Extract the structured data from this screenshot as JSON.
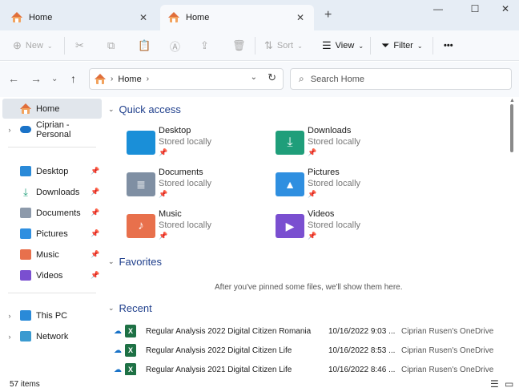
{
  "tabs": [
    {
      "title": "Home",
      "active": false
    },
    {
      "title": "Home",
      "active": true
    }
  ],
  "window_controls": {
    "minimize": "—",
    "maximize": "☐",
    "close": "✕"
  },
  "toolbar": {
    "new_label": "New",
    "sort_label": "Sort",
    "view_label": "View",
    "filter_label": "Filter",
    "more": "•••"
  },
  "address": {
    "current": "Home"
  },
  "search": {
    "placeholder": "Search Home"
  },
  "sidebar": {
    "items": [
      {
        "label": "Home",
        "icon": "home-icon",
        "selected": true
      },
      {
        "label": "Ciprian - Personal",
        "icon": "cloud-icon"
      },
      {
        "label": "Desktop",
        "icon": "desktop-icon",
        "pinned": true
      },
      {
        "label": "Downloads",
        "icon": "downloads-icon",
        "pinned": true
      },
      {
        "label": "Documents",
        "icon": "documents-icon",
        "pinned": true
      },
      {
        "label": "Pictures",
        "icon": "pictures-icon",
        "pinned": true
      },
      {
        "label": "Music",
        "icon": "music-icon",
        "pinned": true
      },
      {
        "label": "Videos",
        "icon": "videos-icon",
        "pinned": true
      },
      {
        "label": "This PC",
        "icon": "pc-icon"
      },
      {
        "label": "Network",
        "icon": "network-icon"
      }
    ]
  },
  "quick_access": {
    "title": "Quick access",
    "items": [
      {
        "name": "Desktop",
        "status": "Stored locally",
        "icon": "desktop-folder-icon",
        "color": "#1a8fd8"
      },
      {
        "name": "Downloads",
        "status": "Stored locally",
        "icon": "downloads-folder-icon",
        "color": "#1f9e7a"
      },
      {
        "name": "Documents",
        "status": "Stored locally",
        "icon": "documents-folder-icon",
        "color": "#7f8fa3"
      },
      {
        "name": "Pictures",
        "status": "Stored locally",
        "icon": "pictures-folder-icon",
        "color": "#2f8fe0"
      },
      {
        "name": "Music",
        "status": "Stored locally",
        "icon": "music-folder-icon",
        "color": "#e8704c"
      },
      {
        "name": "Videos",
        "status": "Stored locally",
        "icon": "videos-folder-icon",
        "color": "#7a4fd0"
      }
    ]
  },
  "favorites": {
    "title": "Favorites",
    "empty_message": "After you've pinned some files, we'll show them here."
  },
  "recent": {
    "title": "Recent",
    "rows": [
      {
        "name": "Regular Analysis 2022 Digital Citizen Romania",
        "date": "10/16/2022 9:03 ...",
        "location": "Ciprian Rusen's OneDrive"
      },
      {
        "name": "Regular Analysis 2022 Digital Citizen Life",
        "date": "10/16/2022 8:53 ...",
        "location": "Ciprian Rusen's OneDrive"
      },
      {
        "name": "Regular Analysis 2021 Digital Citizen Life",
        "date": "10/16/2022 8:46 ...",
        "location": "Ciprian Rusen's OneDrive"
      }
    ]
  },
  "status": {
    "item_count": "57 items"
  }
}
